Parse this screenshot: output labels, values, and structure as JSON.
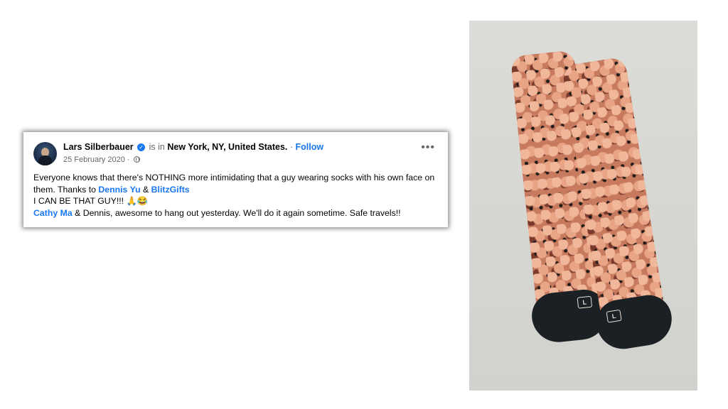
{
  "post": {
    "author": "Lars Silberbauer",
    "is_in": "is in",
    "location": "New York, NY, United States.",
    "separator": " · ",
    "follow_label": "Follow",
    "date": "25 February 2020",
    "date_separator": " · ",
    "more_label": "•••",
    "body": {
      "line1_a": "Everyone knows that there's NOTHING more intimidating that a guy wearing socks with his own face on them. Thanks to ",
      "link_dennis": "Dennis Yu",
      "amp": " & ",
      "link_blitzgifts": "BlitzGifts",
      "line2": "I CAN BE THAT GUY!!! 🙏😂",
      "link_cathy": "Cathy Ma",
      "line3_rest": " & Dennis, awesome to hang out yesterday. We'll do it again sometime. Safe travels!!"
    }
  },
  "photo": {
    "sock_logo": "L"
  },
  "colors": {
    "link": "#1877f2",
    "text": "#050505",
    "muted": "#65676b"
  },
  "icons": [
    "verified-badge-icon",
    "globe-icon",
    "more-options-icon"
  ]
}
